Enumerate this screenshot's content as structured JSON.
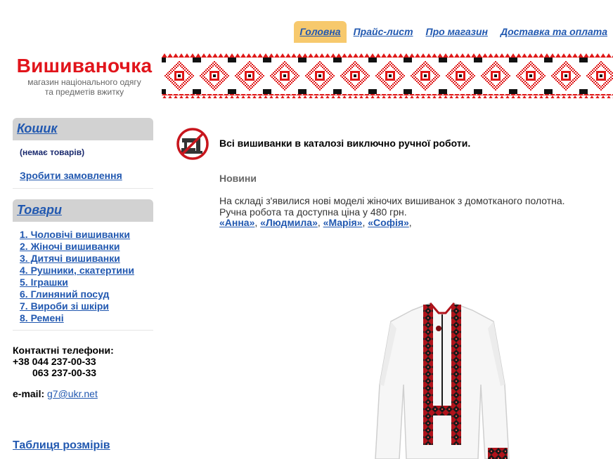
{
  "nav": {
    "items": [
      {
        "label": "Головна",
        "active": true
      },
      {
        "label": "Прайс-лист",
        "active": false
      },
      {
        "label": "Про магазин",
        "active": false
      },
      {
        "label": "Доставка та оплата",
        "active": false
      }
    ]
  },
  "logo": {
    "title": "Вишиваночка",
    "subtitle_line1": "магазин національного одягу",
    "subtitle_line2": "та предметів вжитку"
  },
  "cart": {
    "heading": "Кошик",
    "empty_text": "(немає товарів)",
    "order_link": "Зробити замовлення"
  },
  "products": {
    "heading": "Товари",
    "categories": [
      "1. Чоловічі вишиванки",
      "2. Жіночі вишиванки",
      "3. Дитячі вишиванки",
      "4. Рушники, скатертини",
      "5. Іграшки",
      "6. Глиняний посуд",
      "7. Вироби зі шкіри",
      "8. Ремені"
    ]
  },
  "contacts": {
    "label": "Контактні телефони:",
    "phone1": "+38 044 237-00-33",
    "phone2": "063 237-00-33",
    "email_label": "e-mail:",
    "email": "g7@ukr.net",
    "sizes_link": "Таблиця розмірів"
  },
  "main": {
    "notice": "Всі вишиванки в каталозі виключно ручної роботи.",
    "news_title": "Новини",
    "news_line1": "На складі з'явилися нові моделі жіночих вишиванок з домотканого полотна.",
    "news_line2": "Ручна робота та доступна ціна у 480 грн.",
    "models": [
      "«Анна»",
      "«Людмила»",
      "«Марія»",
      "«Софія»"
    ]
  },
  "colors": {
    "brand_red": "#e1141b",
    "link_blue": "#2158b0",
    "nav_active": "#f7c96d",
    "sidebar_head": "#d2d2d2"
  }
}
